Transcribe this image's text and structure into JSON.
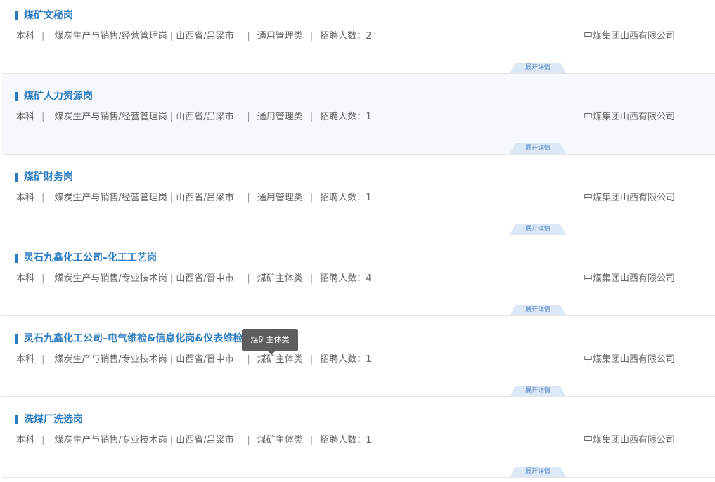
{
  "labels": {
    "count_label": "招聘人数：",
    "expand": "展开详情"
  },
  "tooltip": {
    "text": "煤矿主体类"
  },
  "jobs": [
    {
      "title": "煤矿文秘岗",
      "education": "本科",
      "department": "煤炭生产与销售/经营管理岗 | 山西省/吕梁市",
      "category": "通用管理类",
      "count": "2",
      "company": "中煤集团山西有限公司"
    },
    {
      "title": "煤矿人力资源岗",
      "education": "本科",
      "department": "煤炭生产与销售/经营管理岗 | 山西省/吕梁市",
      "category": "通用管理类",
      "count": "1",
      "company": "中煤集团山西有限公司"
    },
    {
      "title": "煤矿财务岗",
      "education": "本科",
      "department": "煤炭生产与销售/经营管理岗 | 山西省/吕梁市",
      "category": "通用管理类",
      "count": "1",
      "company": "中煤集团山西有限公司"
    },
    {
      "title": "灵石九鑫化工公司–化工工艺岗",
      "education": "本科",
      "department": "煤炭生产与销售/专业技术岗 | 山西省/晋中市",
      "category": "煤矿主体类",
      "count": "4",
      "company": "中煤集团山西有限公司"
    },
    {
      "title": "灵石九鑫化工公司–电气维检&信息化岗&仪表维检岗",
      "education": "本科",
      "department": "煤炭生产与销售/专业技术岗 | 山西省/晋中市",
      "category": "煤矿主体类",
      "count": "1",
      "company": "中煤集团山西有限公司"
    },
    {
      "title": "洗煤厂洗选岗",
      "education": "本科",
      "department": "煤炭生产与销售/专业技术岗 | 山西省/吕梁市",
      "category": "煤矿主体类",
      "count": "1",
      "company": "中煤集团山西有限公司"
    }
  ]
}
